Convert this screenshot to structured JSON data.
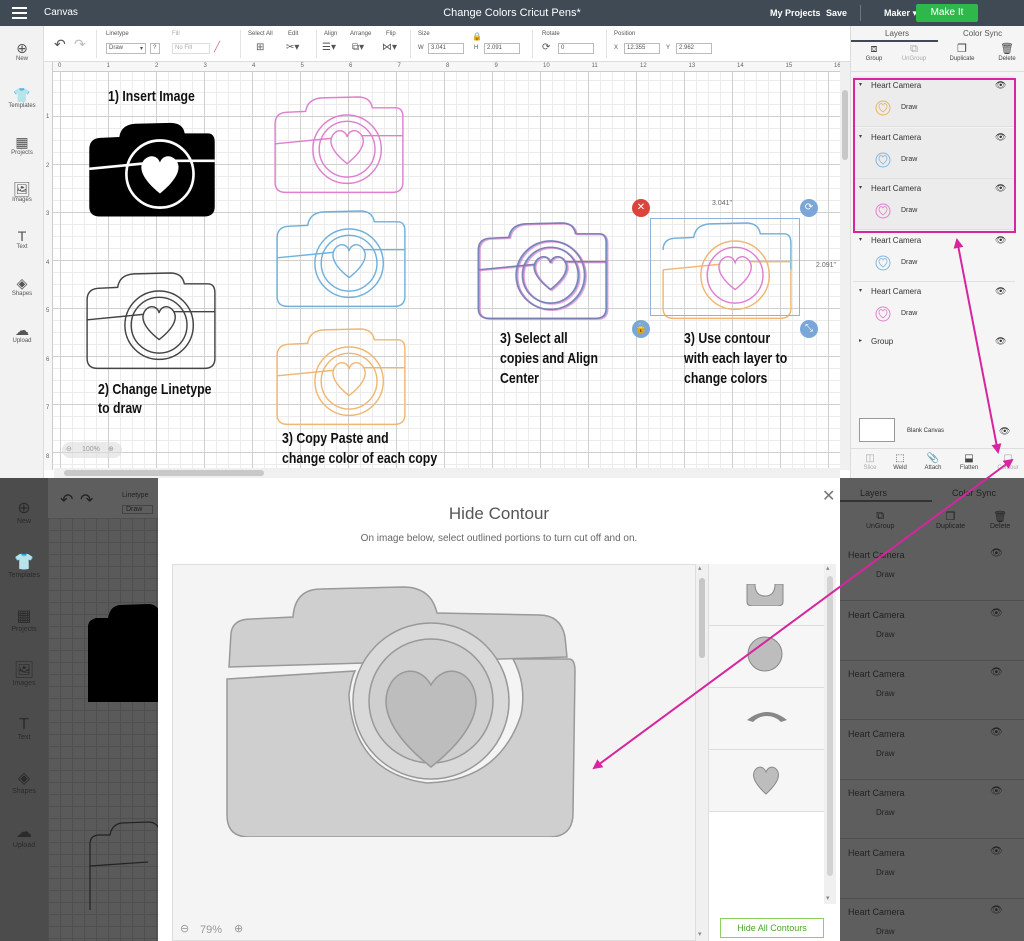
{
  "topbar": {
    "app_name": "Canvas",
    "doc_title": "Change Colors Cricut Pens*",
    "my_projects": "My Projects",
    "save": "Save",
    "machine": "Maker",
    "make_it": "Make It"
  },
  "toolbar": {
    "linetype_label": "Linetype",
    "linetype_value": "Draw",
    "linetype_help": "?",
    "fill_label": "Fill",
    "fill_value": "No Fill",
    "select_all_label": "Select All",
    "edit_label": "Edit",
    "align_label": "Align",
    "arrange_label": "Arrange",
    "flip_label": "Flip",
    "size_label": "Size",
    "w_label": "W",
    "w_value": "3.041",
    "h_label": "H",
    "h_value": "2.091",
    "rotate_label": "Rotate",
    "rotate_value": "0",
    "position_label": "Position",
    "x_label": "X",
    "x_value": "12.355",
    "y_label": "Y",
    "y_value": "2.962"
  },
  "leftbar": [
    {
      "label": "New",
      "icon": "plus-circle-icon"
    },
    {
      "label": "Templates",
      "icon": "shirt-icon"
    },
    {
      "label": "Projects",
      "icon": "grid-icon"
    },
    {
      "label": "Images",
      "icon": "image-icon"
    },
    {
      "label": "Text",
      "icon": "text-icon"
    },
    {
      "label": "Shapes",
      "icon": "shapes-icon"
    },
    {
      "label": "Upload",
      "icon": "upload-cloud-icon"
    }
  ],
  "ruler": {
    "h": [
      "0",
      "1",
      "2",
      "3",
      "4",
      "5",
      "6",
      "7",
      "8",
      "9",
      "10",
      "11",
      "12",
      "13",
      "14",
      "15",
      "16"
    ],
    "v": [
      "1",
      "2",
      "3",
      "4",
      "5",
      "6",
      "7",
      "8"
    ]
  },
  "notes": {
    "insert": "1) Insert Image",
    "linetype_1": "2) Change Linetype",
    "linetype_2": "to draw",
    "copy_1": "3) Copy Paste and",
    "copy_2": "change color of each copy",
    "select_1": "3) Select all",
    "select_2": "copies and Align",
    "select_3": "Center",
    "contour_1": "3) Use contour",
    "contour_2": "with each layer to",
    "contour_3": "change colors"
  },
  "selection": {
    "width_label": "3.041\"",
    "height_label": "2.091\""
  },
  "zoom": {
    "top": "100%",
    "modal": "79%"
  },
  "layers": {
    "tabs": [
      "Layers",
      "Color Sync"
    ],
    "tools": [
      "Group",
      "UnGroup",
      "Duplicate",
      "Delete"
    ],
    "rows": [
      {
        "name": "Heart Camera",
        "sub": "Draw",
        "color": "#e8b45e"
      },
      {
        "name": "Heart Camera",
        "sub": "Draw",
        "color": "#7fb7e0"
      },
      {
        "name": "Heart Camera",
        "sub": "Draw",
        "color": "#e07fcf"
      },
      {
        "name": "Heart Camera",
        "sub": "Draw",
        "color": "#7fb7e0"
      },
      {
        "name": "Heart Camera",
        "sub": "Draw",
        "color": "#e07fcf"
      }
    ],
    "group": "Group",
    "blank_canvas": "Blank Canvas",
    "bottom_tools": [
      "Slice",
      "Weld",
      "Attach",
      "Flatten",
      "Contour"
    ]
  },
  "bottom": {
    "leftbar": [
      {
        "label": "New",
        "icon": "plus-circle-icon"
      },
      {
        "label": "Templates",
        "icon": "shirt-icon"
      },
      {
        "label": "Projects",
        "icon": "grid-icon"
      },
      {
        "label": "Images",
        "icon": "image-icon"
      },
      {
        "label": "Text",
        "icon": "text-icon"
      },
      {
        "label": "Shapes",
        "icon": "shapes-icon"
      },
      {
        "label": "Upload",
        "icon": "upload-cloud-icon"
      }
    ],
    "toolbar": {
      "linetype_label": "Linetype",
      "linetype_value": "Draw"
    },
    "layers_tabs": [
      "Layers",
      "Color Sync"
    ],
    "layers_tools": [
      "Group",
      "UnGroup",
      "Duplicate",
      "Delete"
    ],
    "layer_rows": [
      {
        "name": "Heart Camera",
        "sub": "Draw"
      },
      {
        "name": "Heart Camera",
        "sub": "Draw"
      },
      {
        "name": "Heart Camera",
        "sub": "Draw"
      },
      {
        "name": "Heart Camera",
        "sub": "Draw"
      },
      {
        "name": "Heart Camera",
        "sub": "Draw"
      },
      {
        "name": "Heart Camera",
        "sub": "Draw"
      },
      {
        "name": "Heart Camera",
        "sub": "Draw"
      }
    ]
  },
  "modal": {
    "title": "Hide Contour",
    "subtitle": "On image below, select outlined portions to turn cut off and on.",
    "hide_all": "Hide All Contours"
  },
  "colors": {
    "accent_green": "#2fb84a",
    "highlight_pink": "#d6259e",
    "camera_pink": "#e07fcf",
    "camera_blue": "#6fb1dc",
    "camera_orange": "#f0b773",
    "camera_purple": "#7a7ab0"
  }
}
